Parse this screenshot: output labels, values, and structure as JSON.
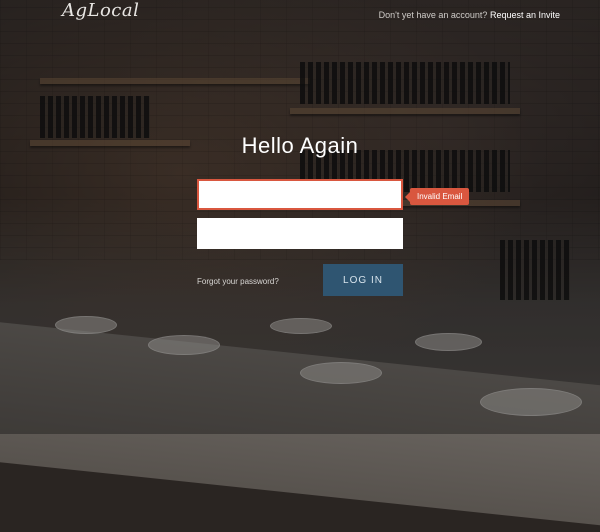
{
  "brand": {
    "logo_text": "AgLocal"
  },
  "topbar": {
    "prompt": "Don't yet have an account?",
    "request_link": "Request an Invite"
  },
  "login": {
    "title": "Hello Again",
    "email": {
      "value": "",
      "error": "Invalid Email"
    },
    "password": {
      "value": ""
    },
    "forgot_label": "Forgot your password?",
    "submit_label": "LOG IN"
  },
  "colors": {
    "error": "#d9573f",
    "button": "#2f5571",
    "text": "#ffffff"
  }
}
